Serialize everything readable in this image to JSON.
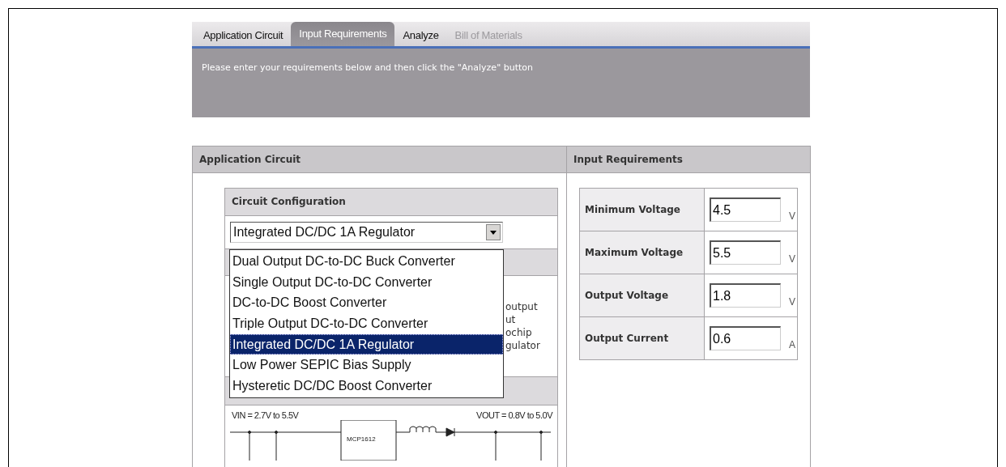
{
  "tabs": [
    {
      "label": "Application Circuit",
      "selected": false,
      "disabled": false
    },
    {
      "label": "Input Requirements",
      "selected": true,
      "disabled": false
    },
    {
      "label": "Analyze",
      "selected": false,
      "disabled": false
    },
    {
      "label": "Bill of Materials",
      "selected": false,
      "disabled": true
    }
  ],
  "banner": {
    "text": "Please enter your requirements below and then click the \"Analyze\" button"
  },
  "application_circuit": {
    "title": "Application Circuit",
    "circuit_configuration": {
      "title": "Circuit Configuration",
      "select": {
        "value": "Integrated DC/DC 1A Regulator"
      },
      "options": [
        {
          "label": "Dual Output DC-to-DC Buck Converter",
          "selected": false
        },
        {
          "label": "Single Output DC-to-DC Converter",
          "selected": false
        },
        {
          "label": "DC-to-DC Boost Converter",
          "selected": false
        },
        {
          "label": "Triple Output DC-to-DC Converter",
          "selected": false
        },
        {
          "label": "Integrated DC/DC 1A Regulator",
          "selected": true
        },
        {
          "label": "Low Power SEPIC Bias Supply",
          "selected": false
        },
        {
          "label": "Hysteretic DC/DC Boost Converter",
          "selected": false
        }
      ]
    },
    "description_fragments": [
      "output",
      "ut",
      "ochip",
      "gulator"
    ],
    "schematic": {
      "vin_label": "VIN = 2.7V to 5.5V",
      "vout_label": "VOUT = 0.8V to 5.0V",
      "chip_label": "MCP1612"
    }
  },
  "input_requirements": {
    "title": "Input Requirements",
    "rows": [
      {
        "label": "Minimum Voltage",
        "value": "4.5",
        "unit": "V"
      },
      {
        "label": "Maximum Voltage",
        "value": "5.5",
        "unit": "V"
      },
      {
        "label": "Output Voltage",
        "value": "1.8",
        "unit": "V"
      },
      {
        "label": "Output Current",
        "value": "0.6",
        "unit": "A"
      }
    ]
  }
}
